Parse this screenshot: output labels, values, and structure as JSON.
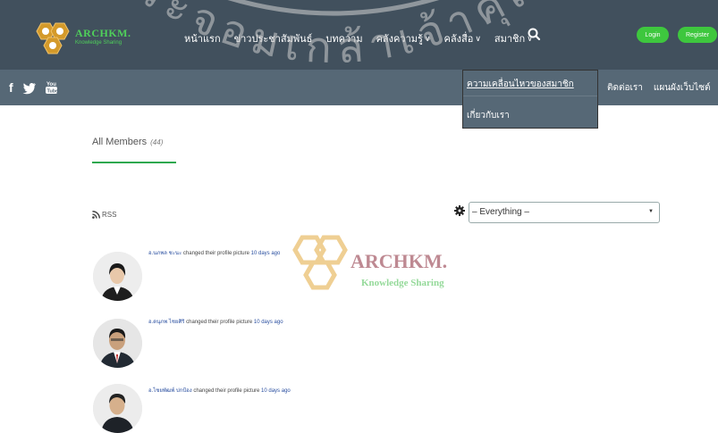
{
  "logo": {
    "title": "ARCHKM.",
    "subtitle": "Knowledge Sharing"
  },
  "watermark_text": "พระจอมเกล้าเจ้าคุณ",
  "nav": {
    "items": [
      {
        "label": "หน้าแรก",
        "has_dropdown": false
      },
      {
        "label": "ข่าวประชาสัมพันธ์",
        "has_dropdown": false
      },
      {
        "label": "บทความ",
        "has_dropdown": false
      },
      {
        "label": "คลังความรู้",
        "has_dropdown": true
      },
      {
        "label": "คลังสื่อ",
        "has_dropdown": true
      },
      {
        "label": "สมาชิก",
        "has_dropdown": true
      }
    ],
    "login_label": "Login",
    "register_label": "Register"
  },
  "subnav": {
    "items": [
      {
        "label": "ติดต่อเรา"
      },
      {
        "label": "แผนผังเว็บไซต์"
      }
    ]
  },
  "member_menu": {
    "items": [
      {
        "label": "ความเคลื่อนไหวของสมาชิก"
      },
      {
        "label": "เกี่ยวกับเรา"
      }
    ]
  },
  "members_tab": {
    "label": "All Members",
    "count": "(44)"
  },
  "rss_label": "RSS",
  "filter": {
    "selected": "– Everything –"
  },
  "activity": [
    {
      "name": "อ.นภพล ชะนะ",
      "action": "changed their profile picture",
      "time": "10 days ago"
    },
    {
      "name": "อ.ดนุภพ ไชยศิริ",
      "action": "changed their profile picture",
      "time": "10 days ago"
    },
    {
      "name": "อ.ไชยพัฒพ์ ปกป้อง",
      "action": "changed their profile picture",
      "time": "10 days ago"
    }
  ],
  "colors": {
    "topbar": "#41505d",
    "subbar": "#566876",
    "accent": "#3ec73e",
    "link": "#2a4fa0"
  }
}
